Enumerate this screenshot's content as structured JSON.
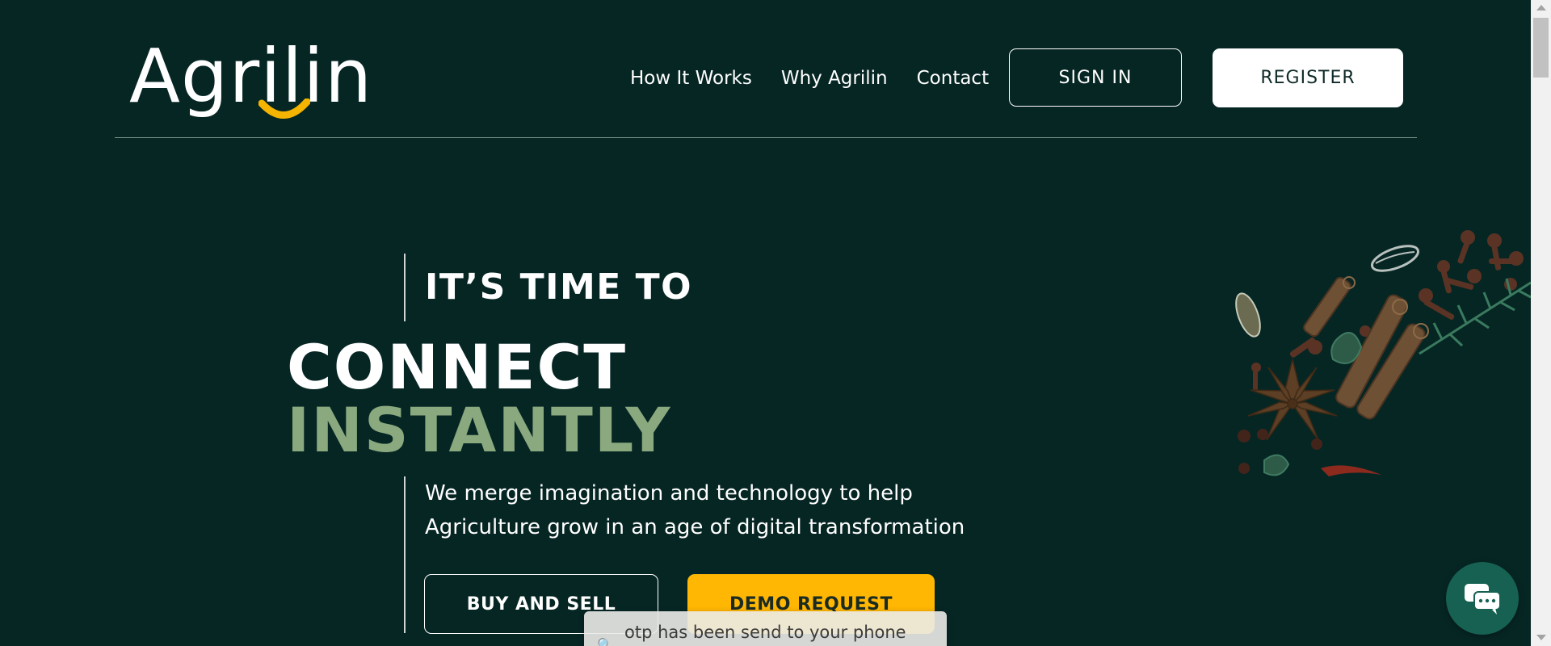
{
  "header": {
    "logo_text": "Agrilin",
    "nav": [
      {
        "label": "How It Works"
      },
      {
        "label": "Why Agrilin"
      },
      {
        "label": "Contact"
      }
    ],
    "sign_in_label": "SIGN IN",
    "register_label": "REGISTER"
  },
  "hero": {
    "kicker": "IT’S TIME TO",
    "headline_line1": "CONNECT",
    "headline_line2": "INSTANTLY",
    "description_line1": "We merge imagination and technology to help",
    "description_line2": "Agriculture grow in an age of digital transformation",
    "buy_sell_label": "BUY AND SELL",
    "demo_label": "DEMO REQUEST"
  },
  "toast": {
    "message": "otp has been send to your phone"
  },
  "colors": {
    "background": "#062624",
    "accent_green": "#8aa97f",
    "accent_yellow": "#ffb703",
    "chat_green": "#166152"
  },
  "icons": {
    "logo_smile": "smile-arc-icon",
    "chat": "chat-bubble-icon",
    "spices": "spices-illustration"
  }
}
